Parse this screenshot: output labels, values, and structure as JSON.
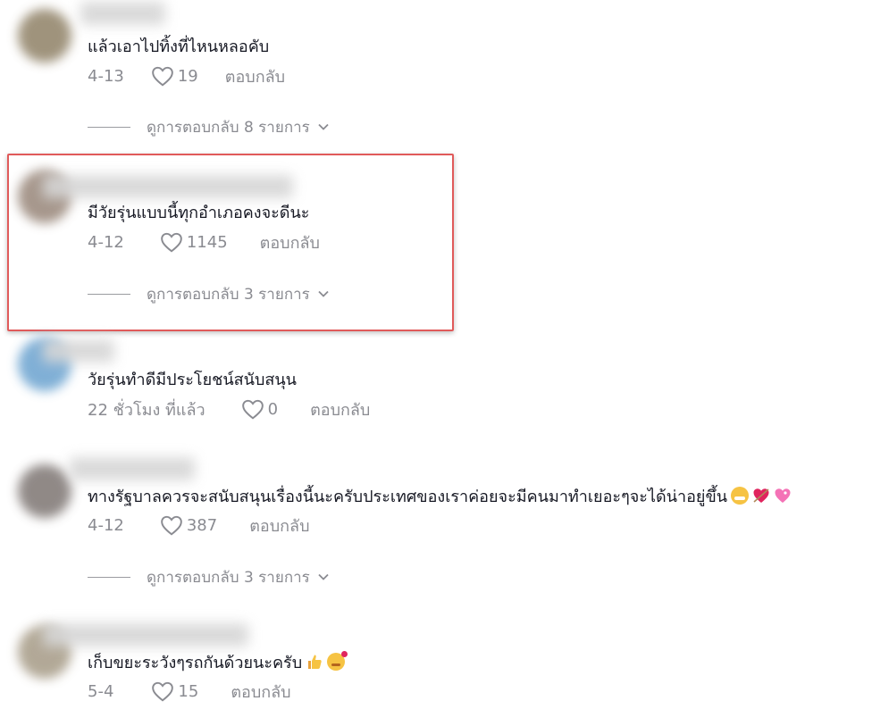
{
  "comments": [
    {
      "text": "แล้วเอาไปทิ้งที่ไหนหลอคับ",
      "date": "4-13",
      "likes": "19",
      "reply_label": "ตอบกลับ",
      "view_replies": "ดูการตอบกลับ 8 รายการ"
    },
    {
      "text": "มีวัยรุ่นแบบนี้ทุกอำเภอคงจะดีนะ",
      "date": "4-12",
      "likes": "1145",
      "reply_label": "ตอบกลับ",
      "view_replies": "ดูการตอบกลับ 3 รายการ"
    },
    {
      "text": "วัยรุ่นทำดีมีประโยชน์สนับสนุน",
      "date": "22 ชั่วโมง ที่แล้ว",
      "likes": "0",
      "reply_label": "ตอบกลับ"
    },
    {
      "text": "ทางรัฐบาลควรจะสนับสนุนเรื่องนี้นะครับประเทศของเราค่อยจะมีคนมาทำเยอะๆจะได้น่าอยู่ขึ้น",
      "date": "4-12",
      "likes": "387",
      "reply_label": "ตอบกลับ",
      "view_replies": "ดูการตอบกลับ 3 รายการ"
    },
    {
      "text": "เก็บขยะระวังๆรถกันด้วยนะครับ",
      "date": "5-4",
      "likes": "15",
      "reply_label": "ตอบกลับ"
    }
  ],
  "icons": [
    "heart-icon",
    "chevron-down-icon",
    "grin-emoji",
    "heart-arrow-emoji",
    "sparkle-heart-emoji",
    "thumbs-up-emoji",
    "smiling-hearts-emoji"
  ],
  "colors": {
    "highlight": "#e05a5a",
    "muted": "#8a8b91",
    "text": "#161823"
  }
}
